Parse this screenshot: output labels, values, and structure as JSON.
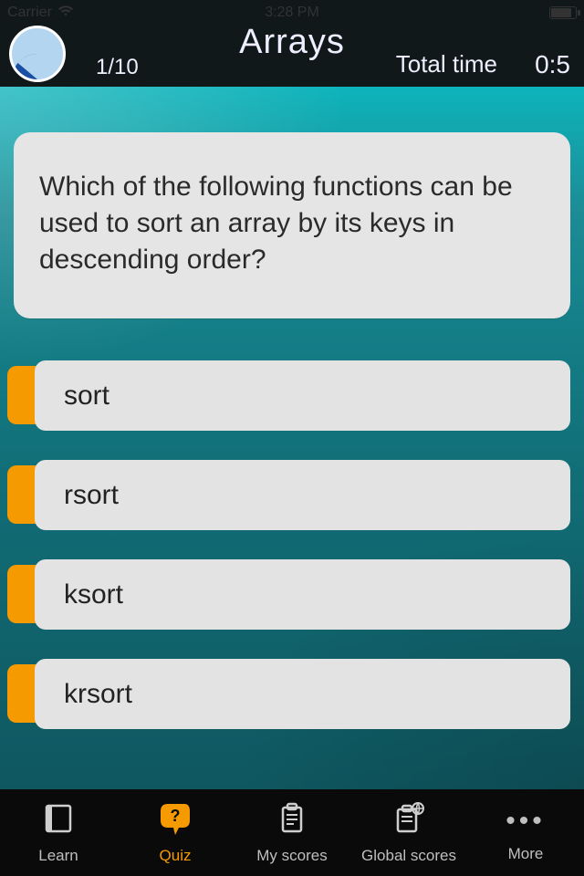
{
  "status_bar": {
    "carrier": "Carrier",
    "time": "3:28 PM"
  },
  "header": {
    "title": "Arrays",
    "progress_label": "1/10",
    "total_time_label": "Total time",
    "total_time_value": "0:5"
  },
  "question": {
    "text": "Which of the following functions can be used to sort an array by its keys in descending order?"
  },
  "answers": [
    {
      "label": "sort"
    },
    {
      "label": "rsort"
    },
    {
      "label": "ksort"
    },
    {
      "label": "krsort"
    }
  ],
  "tabs": {
    "learn": "Learn",
    "quiz": "Quiz",
    "my_scores": "My scores",
    "global_scores": "Global scores",
    "more": "More",
    "active": "quiz"
  },
  "colors": {
    "accent_orange": "#f59a00",
    "header_bg": "#10181a",
    "card_bg": "#e5e5e5"
  }
}
